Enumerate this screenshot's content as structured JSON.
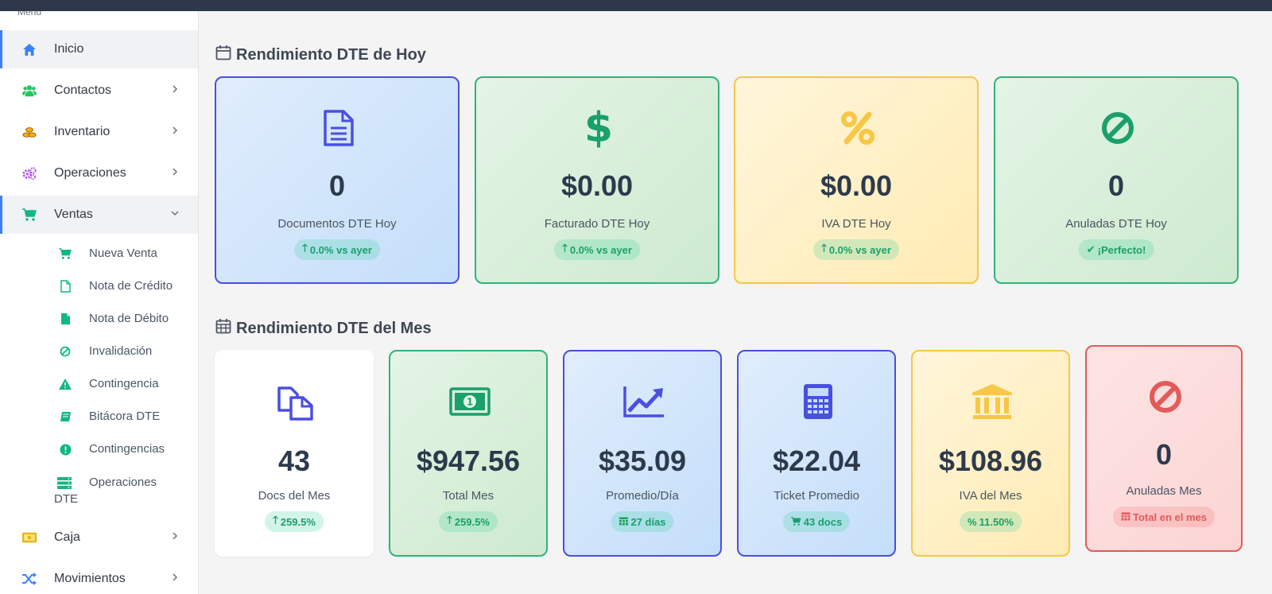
{
  "sidebar": {
    "caption": "Menu",
    "items": [
      {
        "label": "Inicio",
        "icon": "home-icon"
      },
      {
        "label": "Contactos",
        "icon": "users-icon"
      },
      {
        "label": "Inventario",
        "icon": "coins-icon"
      },
      {
        "label": "Operaciones",
        "icon": "cogs-icon"
      },
      {
        "label": "Ventas",
        "icon": "cart-icon"
      },
      {
        "label": "Caja",
        "icon": "money-icon"
      },
      {
        "label": "Movimientos",
        "icon": "shuffle-icon"
      }
    ],
    "subitems": [
      {
        "label": "Nueva Venta",
        "icon": "cart-icon"
      },
      {
        "label": "Nota de Crédito",
        "icon": "file-outline-icon"
      },
      {
        "label": "Nota de Débito",
        "icon": "file-icon"
      },
      {
        "label": "Invalidación",
        "icon": "ban-icon"
      },
      {
        "label": "Contingencia",
        "icon": "warning-icon"
      },
      {
        "label": "Bitácora DTE",
        "icon": "book-icon"
      },
      {
        "label": "Contingencias",
        "icon": "exclamation-icon"
      },
      {
        "label_line1": "Operaciones",
        "label_line2": "DTE",
        "icon": "server-icon"
      }
    ]
  },
  "today": {
    "title": "Rendimiento DTE de Hoy",
    "cards": [
      {
        "value": "0",
        "label": "Documentos DTE Hoy",
        "badge": "0.0% vs ayer",
        "icon": "document-icon"
      },
      {
        "value": "$0.00",
        "label": "Facturado DTE Hoy",
        "badge": "0.0% vs ayer",
        "icon": "dollar-icon"
      },
      {
        "value": "$0.00",
        "label": "IVA DTE Hoy",
        "badge": "0.0% vs ayer",
        "icon": "percent-icon"
      },
      {
        "value": "0",
        "label": "Anuladas DTE Hoy",
        "badge": "¡Perfecto!",
        "icon": "ban-icon"
      }
    ]
  },
  "month": {
    "title": "Rendimiento DTE del Mes",
    "cards": [
      {
        "value": "43",
        "label": "Docs del Mes",
        "badge": "259.5%",
        "icon": "copy-icon"
      },
      {
        "value": "$947.56",
        "label": "Total Mes",
        "badge": "259.5%",
        "icon": "banknote-icon"
      },
      {
        "value": "$35.09",
        "label": "Promedio/Día",
        "badge": "27 días",
        "icon": "chart-line-icon"
      },
      {
        "value": "$22.04",
        "label": "Ticket Promedio",
        "badge": "43 docs",
        "icon": "calculator-icon"
      },
      {
        "value": "$108.96",
        "label": "IVA del Mes",
        "badge": "11.50%",
        "icon": "bank-icon"
      },
      {
        "value": "0",
        "label": "Anuladas Mes",
        "badge": "Total en el mes",
        "icon": "ban-icon"
      }
    ]
  },
  "colors": {
    "accent_blue": "#4a4fe0",
    "accent_green": "#2fb37a",
    "accent_yellow": "#f7c745",
    "accent_red": "#e35a5a"
  }
}
